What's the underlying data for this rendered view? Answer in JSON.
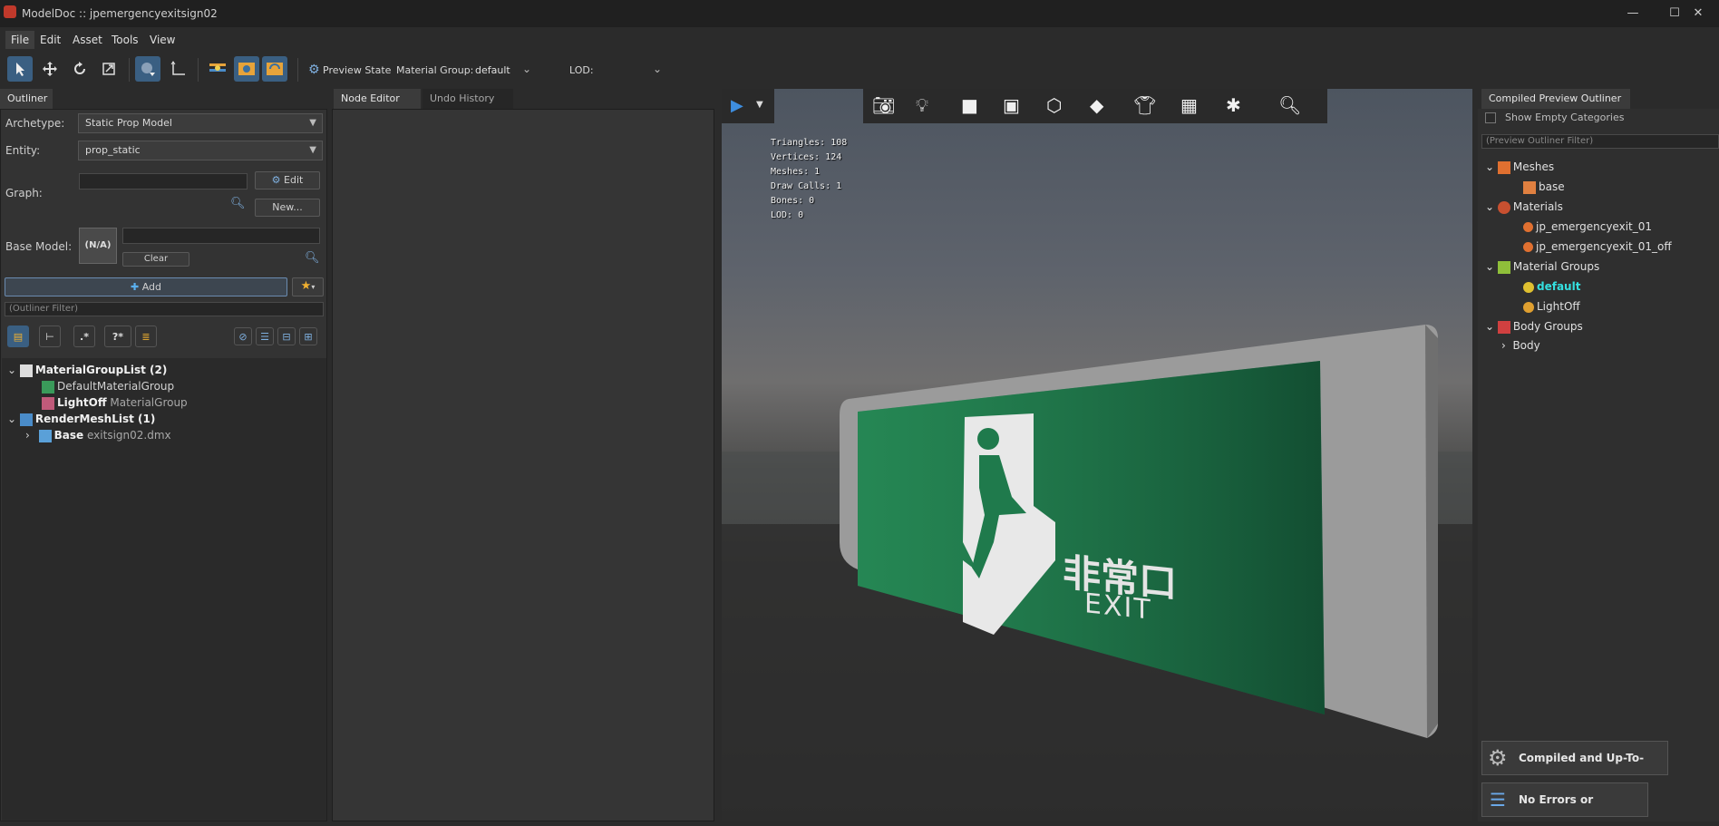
{
  "window": {
    "title": "ModelDoc :: jpemergencyexitsign02"
  },
  "menu": [
    "File",
    "Edit",
    "Asset",
    "Tools",
    "View"
  ],
  "toolbar": {
    "preview_state": "Preview State",
    "material_group_label": "Material Group:",
    "material_group_value": "default",
    "lod_label": "LOD:",
    "lod_value": ""
  },
  "outliner": {
    "tab": "Outliner",
    "archetype_label": "Archetype:",
    "archetype_value": "Static Prop Model",
    "entity_label": "Entity:",
    "entity_value": "prop_static",
    "graph_label": "Graph:",
    "graph_value": "",
    "edit_button": "Edit",
    "new_button": "New...",
    "base_model_label": "Base Model:",
    "base_model_thumb": "(N/A)",
    "base_model_value": "",
    "clear_button": "Clear",
    "add_button": "Add",
    "filter_placeholder": "(Outliner Filter)",
    "tree": [
      {
        "bold": "MaterialGroupList (2)",
        "rest": ""
      },
      {
        "bold": "",
        "rest": "DefaultMaterialGroup"
      },
      {
        "bold": "LightOff",
        "rest": "MaterialGroup"
      },
      {
        "bold": "RenderMeshList (1)",
        "rest": ""
      },
      {
        "bold": "Base",
        "rest": "exitsign02.dmx"
      }
    ]
  },
  "center_tabs": {
    "node_editor": "Node Editor",
    "undo_history": "Undo History"
  },
  "viewport": {
    "stats": [
      "Triangles: 108",
      "Vertices: 124",
      "Meshes: 1",
      "Draw Calls: 1",
      "Bones: 0",
      "LOD: 0"
    ],
    "sign_text_jp": "非常口",
    "sign_text_en": "EXIT"
  },
  "compiled": {
    "tab": "Compiled Preview Outliner",
    "show_empty": "Show Empty Categories",
    "filter_placeholder": "(Preview Outliner Filter)",
    "tree": [
      {
        "label": "Meshes"
      },
      {
        "label": "base"
      },
      {
        "label": "Materials"
      },
      {
        "label": "jp_emergencyexit_01"
      },
      {
        "label": "jp_emergencyexit_01_off"
      },
      {
        "label": "Material Groups"
      },
      {
        "label": "default"
      },
      {
        "label": "LightOff"
      },
      {
        "label": "Body Groups"
      },
      {
        "label": "Body"
      }
    ],
    "status_compiled": "Compiled and Up-To-Date",
    "status_errors": "No Errors or Warnings"
  },
  "colors": {
    "accent": "#3a5f82",
    "highlight": "#34e0e0",
    "sign_green": "#1f7a4c"
  }
}
